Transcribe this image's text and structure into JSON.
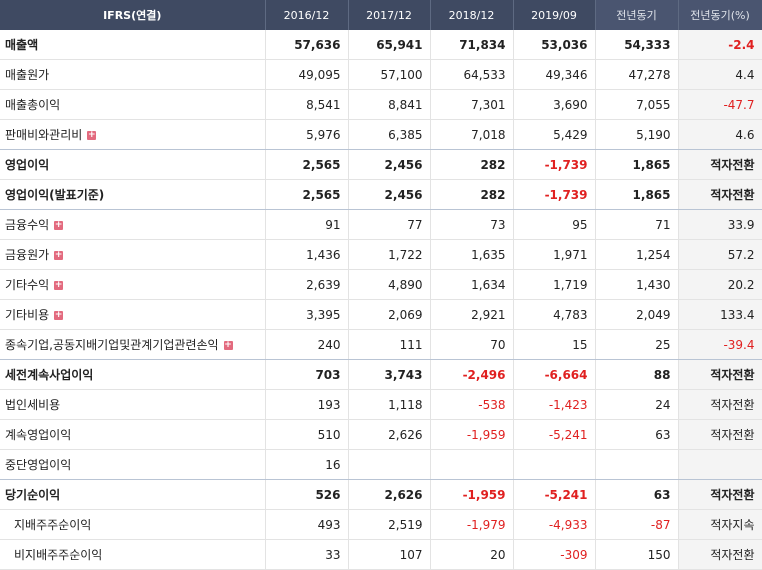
{
  "header": {
    "label": "IFRS(연결)",
    "columns": [
      "2016/12",
      "2017/12",
      "2018/12",
      "2019/09",
      "전년동기",
      "전년동기(%)"
    ]
  },
  "rows": [
    {
      "label": "매출액",
      "bold": true,
      "expand": false,
      "indent": false,
      "values": [
        "57,636",
        "65,941",
        "71,834",
        "53,036",
        "54,333",
        "-2.4"
      ]
    },
    {
      "label": "매출원가",
      "bold": false,
      "expand": false,
      "indent": false,
      "values": [
        "49,095",
        "57,100",
        "64,533",
        "49,346",
        "47,278",
        "4.4"
      ]
    },
    {
      "label": "매출총이익",
      "bold": false,
      "expand": false,
      "indent": false,
      "values": [
        "8,541",
        "8,841",
        "7,301",
        "3,690",
        "7,055",
        "-47.7"
      ]
    },
    {
      "label": "판매비와관리비",
      "bold": false,
      "expand": true,
      "indent": false,
      "values": [
        "5,976",
        "6,385",
        "7,018",
        "5,429",
        "5,190",
        "4.6"
      ]
    },
    {
      "label": "영업이익",
      "bold": true,
      "expand": false,
      "indent": false,
      "values": [
        "2,565",
        "2,456",
        "282",
        "-1,739",
        "1,865",
        "적자전환"
      ]
    },
    {
      "label": "영업이익(발표기준)",
      "bold": true,
      "expand": false,
      "indent": false,
      "values": [
        "2,565",
        "2,456",
        "282",
        "-1,739",
        "1,865",
        "적자전환"
      ]
    },
    {
      "label": "금융수익",
      "bold": false,
      "expand": true,
      "indent": false,
      "values": [
        "91",
        "77",
        "73",
        "95",
        "71",
        "33.9"
      ]
    },
    {
      "label": "금융원가",
      "bold": false,
      "expand": true,
      "indent": false,
      "values": [
        "1,436",
        "1,722",
        "1,635",
        "1,971",
        "1,254",
        "57.2"
      ]
    },
    {
      "label": "기타수익",
      "bold": false,
      "expand": true,
      "indent": false,
      "values": [
        "2,639",
        "4,890",
        "1,634",
        "1,719",
        "1,430",
        "20.2"
      ]
    },
    {
      "label": "기타비용",
      "bold": false,
      "expand": true,
      "indent": false,
      "values": [
        "3,395",
        "2,069",
        "2,921",
        "4,783",
        "2,049",
        "133.4"
      ]
    },
    {
      "label": "종속기업,공동지배기업및관계기업관련손익",
      "bold": false,
      "expand": true,
      "indent": false,
      "values": [
        "240",
        "111",
        "70",
        "15",
        "25",
        "-39.4"
      ]
    },
    {
      "label": "세전계속사업이익",
      "bold": true,
      "expand": false,
      "indent": false,
      "values": [
        "703",
        "3,743",
        "-2,496",
        "-6,664",
        "88",
        "적자전환"
      ]
    },
    {
      "label": "법인세비용",
      "bold": false,
      "expand": false,
      "indent": false,
      "values": [
        "193",
        "1,118",
        "-538",
        "-1,423",
        "24",
        "적자전환"
      ]
    },
    {
      "label": "계속영업이익",
      "bold": false,
      "expand": false,
      "indent": false,
      "values": [
        "510",
        "2,626",
        "-1,959",
        "-5,241",
        "63",
        "적자전환"
      ]
    },
    {
      "label": "중단영업이익",
      "bold": false,
      "expand": false,
      "indent": false,
      "values": [
        "16",
        "",
        "",
        "",
        "",
        ""
      ]
    },
    {
      "label": "당기순이익",
      "bold": true,
      "expand": false,
      "indent": false,
      "values": [
        "526",
        "2,626",
        "-1,959",
        "-5,241",
        "63",
        "적자전환"
      ]
    },
    {
      "label": "지배주주순이익",
      "bold": false,
      "expand": false,
      "indent": true,
      "values": [
        "493",
        "2,519",
        "-1,979",
        "-4,933",
        "-87",
        "적자지속"
      ]
    },
    {
      "label": "비지배주주순이익",
      "bold": false,
      "expand": false,
      "indent": true,
      "values": [
        "33",
        "107",
        "20",
        "-309",
        "150",
        "적자전환"
      ]
    }
  ],
  "expand_symbol": "+",
  "colors": {
    "header_bg": "#3f4a62",
    "negative": "#e02020",
    "expand_icon": "#e36a7e"
  }
}
